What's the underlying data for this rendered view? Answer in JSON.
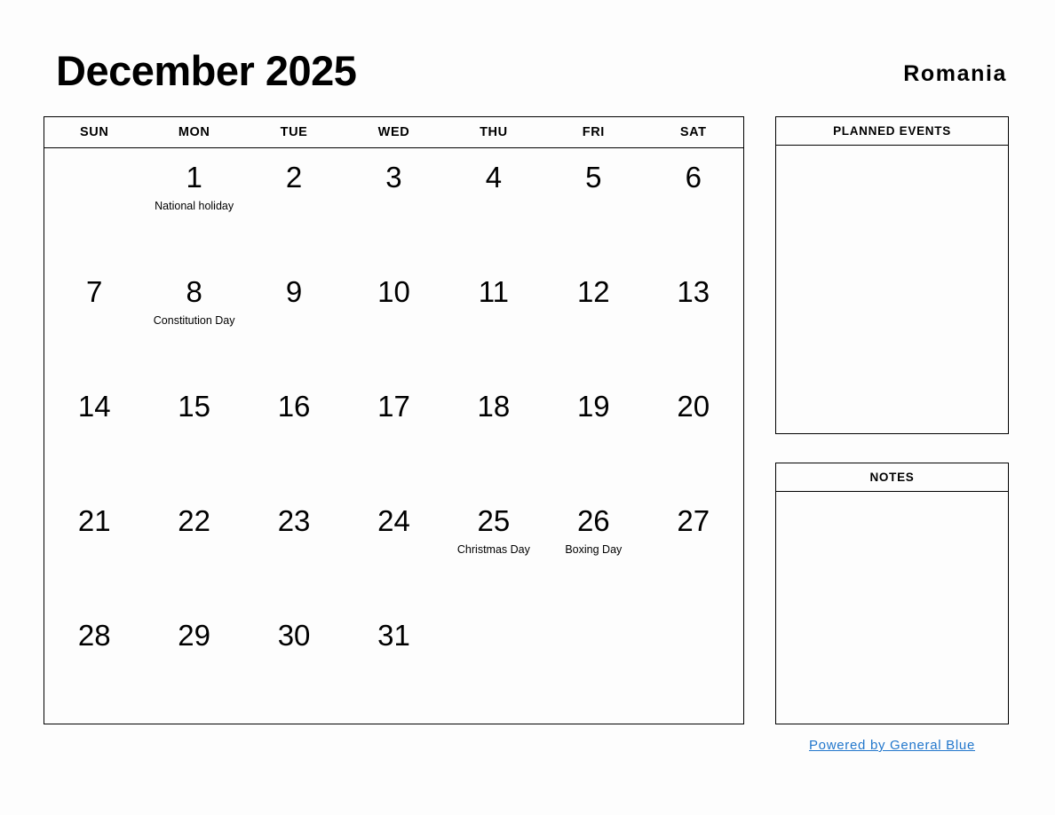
{
  "header": {
    "title": "December 2025",
    "country": "Romania"
  },
  "calendar": {
    "weekdays": [
      "SUN",
      "MON",
      "TUE",
      "WED",
      "THU",
      "FRI",
      "SAT"
    ],
    "weeks": [
      [
        {
          "num": "",
          "event": ""
        },
        {
          "num": "1",
          "event": "National holiday"
        },
        {
          "num": "2",
          "event": ""
        },
        {
          "num": "3",
          "event": ""
        },
        {
          "num": "4",
          "event": ""
        },
        {
          "num": "5",
          "event": ""
        },
        {
          "num": "6",
          "event": ""
        }
      ],
      [
        {
          "num": "7",
          "event": ""
        },
        {
          "num": "8",
          "event": "Constitution Day"
        },
        {
          "num": "9",
          "event": ""
        },
        {
          "num": "10",
          "event": ""
        },
        {
          "num": "11",
          "event": ""
        },
        {
          "num": "12",
          "event": ""
        },
        {
          "num": "13",
          "event": ""
        }
      ],
      [
        {
          "num": "14",
          "event": ""
        },
        {
          "num": "15",
          "event": ""
        },
        {
          "num": "16",
          "event": ""
        },
        {
          "num": "17",
          "event": ""
        },
        {
          "num": "18",
          "event": ""
        },
        {
          "num": "19",
          "event": ""
        },
        {
          "num": "20",
          "event": ""
        }
      ],
      [
        {
          "num": "21",
          "event": ""
        },
        {
          "num": "22",
          "event": ""
        },
        {
          "num": "23",
          "event": ""
        },
        {
          "num": "24",
          "event": ""
        },
        {
          "num": "25",
          "event": "Christmas Day"
        },
        {
          "num": "26",
          "event": "Boxing Day"
        },
        {
          "num": "27",
          "event": ""
        }
      ],
      [
        {
          "num": "28",
          "event": ""
        },
        {
          "num": "29",
          "event": ""
        },
        {
          "num": "30",
          "event": ""
        },
        {
          "num": "31",
          "event": ""
        },
        {
          "num": "",
          "event": ""
        },
        {
          "num": "",
          "event": ""
        },
        {
          "num": "",
          "event": ""
        }
      ]
    ]
  },
  "panels": {
    "planned_events": {
      "title": "PLANNED EVENTS",
      "content": ""
    },
    "notes": {
      "title": "NOTES",
      "content": ""
    }
  },
  "footer": {
    "link_text": "Powered by General Blue",
    "link_color": "#2277cc"
  }
}
